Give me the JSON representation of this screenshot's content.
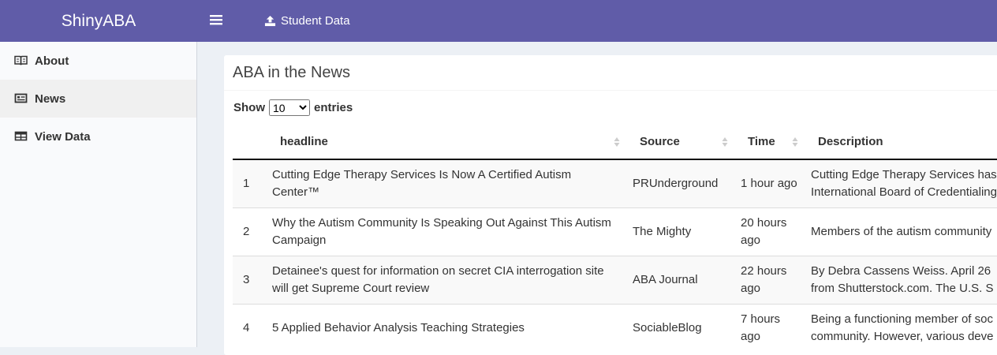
{
  "app": {
    "brand": "ShinyABA",
    "upload_label": "Student Data"
  },
  "sidebar": {
    "items": [
      {
        "label": "About",
        "icon": "book-open-icon"
      },
      {
        "label": "News",
        "icon": "newspaper-icon"
      },
      {
        "label": "View Data",
        "icon": "table-icon"
      }
    ]
  },
  "main": {
    "title": "ABA in the News",
    "length_show": "Show",
    "length_value": "10",
    "length_entries": "entries",
    "columns": [
      "",
      "headline",
      "Source",
      "Time",
      "Description"
    ],
    "rows": [
      {
        "num": "1",
        "headline": "Cutting Edge Therapy Services Is Now A Certified Autism Center™",
        "source": "PRUnderground",
        "time": "1 hour ago",
        "desc": "Cutting Edge Therapy Services has International Board of Credentialing"
      },
      {
        "num": "2",
        "headline": "Why the Autism Community Is Speaking Out Against This Autism Campaign",
        "source": "The Mighty",
        "time": "20 hours ago",
        "desc": "Members of the autism community"
      },
      {
        "num": "3",
        "headline": "Detainee's quest for information on secret CIA interrogation site will get Supreme Court review",
        "source": "ABA Journal",
        "time": "22 hours ago",
        "desc": "By Debra Cassens Weiss. April 26 from Shutterstock.com. The U.S. S"
      },
      {
        "num": "4",
        "headline": "5 Applied Behavior Analysis Teaching Strategies",
        "source": "SociableBlog",
        "time": "7 hours ago",
        "desc": "Being a functioning member of soc community. However, various deve"
      }
    ]
  },
  "colors": {
    "accent": "#605ca8",
    "sidebar_bg": "#f9fafc",
    "content_bg": "#ecf0f5"
  }
}
